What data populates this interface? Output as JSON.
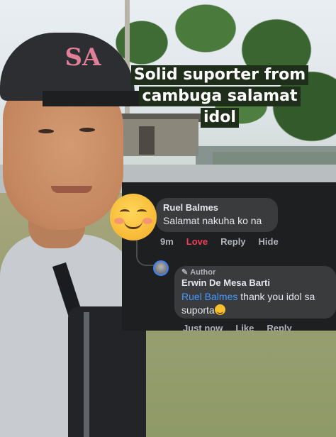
{
  "caption": {
    "line1": "Solid suporter from",
    "line2": "cambuga salamat",
    "line3": "idol"
  },
  "cap_logo": "SA",
  "comment": {
    "author": "Ruel Balmes",
    "text": "Salamat nakuha ko na",
    "time": "9m",
    "love": "Love",
    "reply": "Reply",
    "hide": "Hide"
  },
  "reply": {
    "badge": "Author",
    "author": "Erwin De Mesa Barti",
    "mention": "Ruel Balmes",
    "text_line1": " thank you idol sa",
    "text_line2": "suporta",
    "time": "Just now",
    "like": "Like",
    "reply": "Reply"
  },
  "colors": {
    "panel_bg": "#1e1f21",
    "bubble_bg": "#3a3b3c",
    "mention": "#4599ff",
    "love": "#f33e58",
    "caption_bg": "#1f2d1b"
  },
  "icons": [
    "smiling-face-emoji-icon",
    "pencil-icon",
    "avatar-icon"
  ]
}
